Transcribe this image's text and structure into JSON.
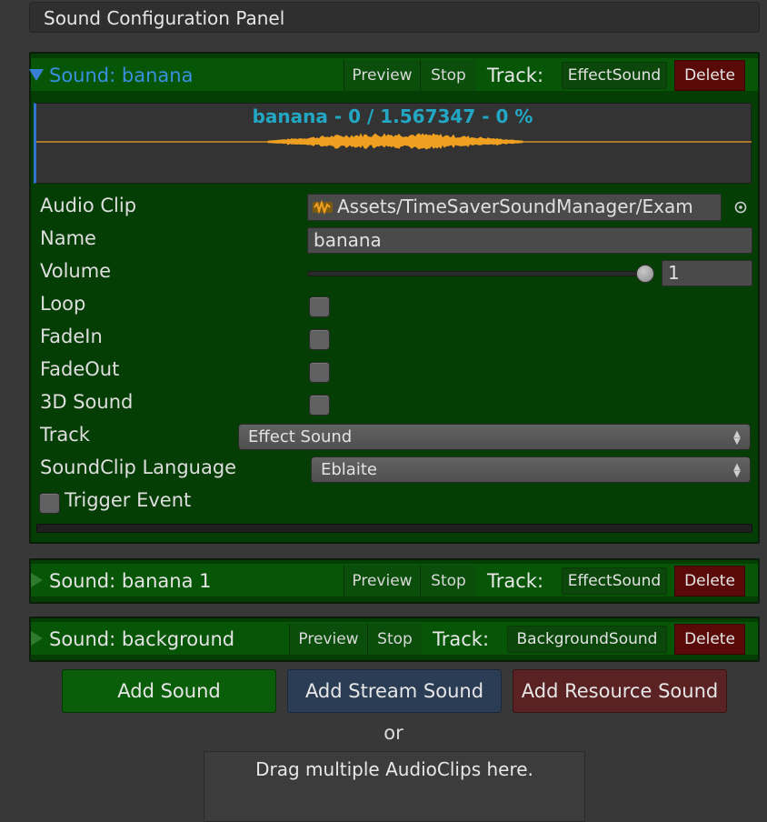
{
  "panel": {
    "title": "Sound Configuration Panel"
  },
  "sounds": [
    {
      "title": "Sound: banana",
      "expanded": true,
      "preview_label": "Preview",
      "stop_label": "Stop",
      "track_label": "Track:",
      "track_value": "EffectSound",
      "delete_label": "Delete",
      "waveform_label": "banana - 0 / 1.567347 - 0 %",
      "fields": {
        "audio_clip_label": "Audio Clip",
        "audio_clip_value": "Assets/TimeSaverSoundManager/Exam",
        "name_label": "Name",
        "name_value": "banana",
        "volume_label": "Volume",
        "volume_value": "1",
        "volume_level": 1.0,
        "loop_label": "Loop",
        "loop_checked": false,
        "fadein_label": "FadeIn",
        "fadein_checked": false,
        "fadeout_label": "FadeOut",
        "fadeout_checked": false,
        "sound3d_label": "3D Sound",
        "sound3d_checked": false,
        "track_label": "Track",
        "track_option": "Effect Sound",
        "language_label": "SoundClip Language",
        "language_option": "Eblaite",
        "trigger_label": "Trigger Event",
        "trigger_checked": false
      }
    },
    {
      "title": "Sound: banana 1",
      "expanded": false,
      "preview_label": "Preview",
      "stop_label": "Stop",
      "track_label": "Track:",
      "track_value": "EffectSound",
      "delete_label": "Delete"
    },
    {
      "title": "Sound: background",
      "expanded": false,
      "preview_label": "Preview",
      "stop_label": "Stop",
      "track_label": "Track:",
      "track_value": "BackgroundSound",
      "delete_label": "Delete"
    }
  ],
  "actions": {
    "add_sound": "Add Sound",
    "add_stream_sound": "Add Stream Sound",
    "add_resource_sound": "Add Resource Sound",
    "or_text": "or",
    "drop_zone_text": "Drag multiple AudioClips here."
  },
  "colors": {
    "waveform": "#f0a020",
    "waveform_label": "#22a8c4",
    "sound_bg": "#053e05",
    "delete_bg": "#5a0909"
  },
  "icons": {
    "audio_clip": "audio-file-icon",
    "object_picker": "target-circle-icon",
    "expanded": "triangle-down-icon",
    "collapsed": "triangle-right-icon"
  }
}
